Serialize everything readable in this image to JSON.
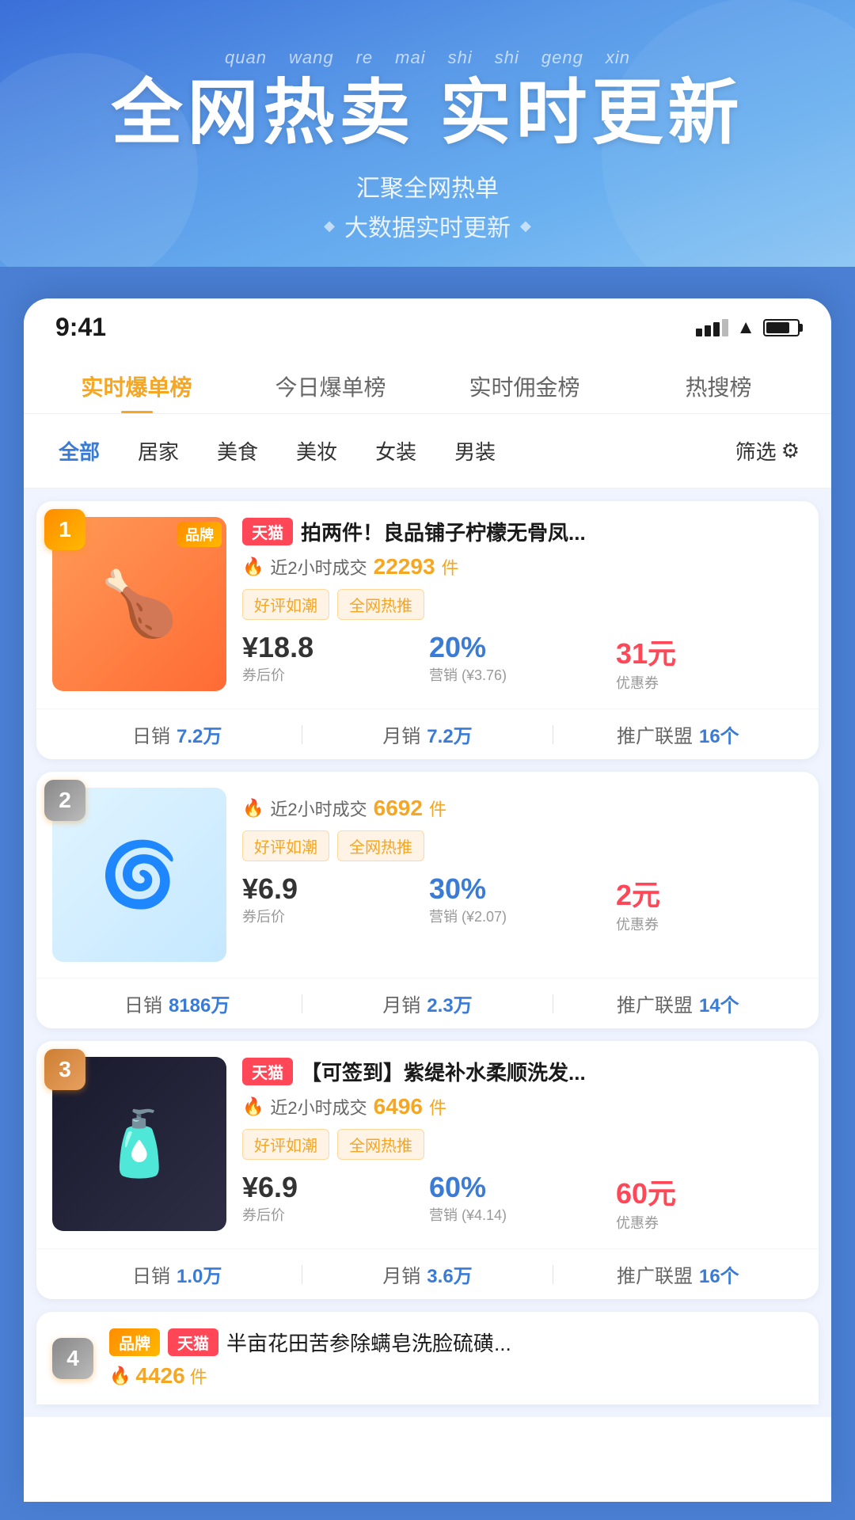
{
  "hero": {
    "pinyin": [
      "quan",
      "wang",
      "re",
      "mai",
      "shi",
      "shi",
      "geng",
      "xin"
    ],
    "title": "全网热卖 实时更新",
    "subtitle1": "汇聚全网热单",
    "subtitle2": "大数据实时更新"
  },
  "status_bar": {
    "time": "9:41"
  },
  "main_tabs": [
    {
      "label": "实时爆单榜",
      "active": true
    },
    {
      "label": "今日爆单榜",
      "active": false
    },
    {
      "label": "实时佣金榜",
      "active": false
    },
    {
      "label": "热搜榜",
      "active": false
    }
  ],
  "categories": [
    {
      "label": "全部",
      "active": true
    },
    {
      "label": "居家",
      "active": false
    },
    {
      "label": "美食",
      "active": false
    },
    {
      "label": "美妆",
      "active": false
    },
    {
      "label": "女装",
      "active": false
    },
    {
      "label": "男装",
      "active": false
    },
    {
      "label": "筛选",
      "active": false,
      "icon": "filter"
    }
  ],
  "products": [
    {
      "rank": "1",
      "rank_class": "rank1",
      "has_brand_tag": true,
      "brand_tag": "品牌",
      "platform": "天猫",
      "title": "拍两件！良品铺子柠檬无骨凤...",
      "sales_label": "近2小时成交",
      "sales_count": "22293",
      "sales_unit": "件",
      "tags": [
        "好评如潮",
        "全网热推"
      ],
      "price": "¥18.8",
      "price_label": "券后价",
      "commission": "20%",
      "commission_sub": "营销 (¥3.76)",
      "coupon": "31元",
      "coupon_label": "优惠券",
      "daily_sales_label": "日销",
      "daily_sales": "7.2万",
      "monthly_sales_label": "月销",
      "monthly_sales": "7.2万",
      "alliance_label": "推广联盟",
      "alliance_count": "16个",
      "img_type": "food",
      "img_emoji": "🍗"
    },
    {
      "rank": "2",
      "rank_class": "rank2",
      "has_brand_tag": false,
      "platform": "",
      "title": "",
      "sales_label": "近2小时成交",
      "sales_count": "6692",
      "sales_unit": "件",
      "tags": [
        "好评如潮",
        "全网热推"
      ],
      "price": "¥6.9",
      "price_label": "券后价",
      "commission": "30%",
      "commission_sub": "营销 (¥2.07)",
      "coupon": "2元",
      "coupon_label": "优惠券",
      "daily_sales_label": "日销",
      "daily_sales": "8186万",
      "monthly_sales_label": "月销",
      "monthly_sales": "2.3万",
      "alliance_label": "推广联盟",
      "alliance_count": "14个",
      "img_type": "fan",
      "img_emoji": "🌀"
    },
    {
      "rank": "3",
      "rank_class": "rank3",
      "has_tmall_tag": true,
      "platform": "天猫",
      "title": "【可签到】紫缇补水柔顺洗发...",
      "sales_label": "近2小时成交",
      "sales_count": "6496",
      "sales_unit": "件",
      "tags": [
        "好评如潮",
        "全网热推"
      ],
      "price": "¥6.9",
      "price_label": "券后价",
      "commission": "60%",
      "commission_sub": "营销 (¥4.14)",
      "coupon": "60元",
      "coupon_label": "优惠券",
      "daily_sales_label": "日销",
      "daily_sales": "1.0万",
      "monthly_sales_label": "月销",
      "monthly_sales": "3.6万",
      "alliance_label": "推广联盟",
      "alliance_count": "16个",
      "img_type": "shampoo",
      "img_emoji": "🧴"
    }
  ],
  "product4": {
    "rank": "4",
    "rank_class": "rank4",
    "brand_tag": "品牌",
    "platform": "天猫",
    "title": "半亩花田苦参除螨皂洗脸硫磺...",
    "sales_count": "4426",
    "sales_unit": "件"
  }
}
